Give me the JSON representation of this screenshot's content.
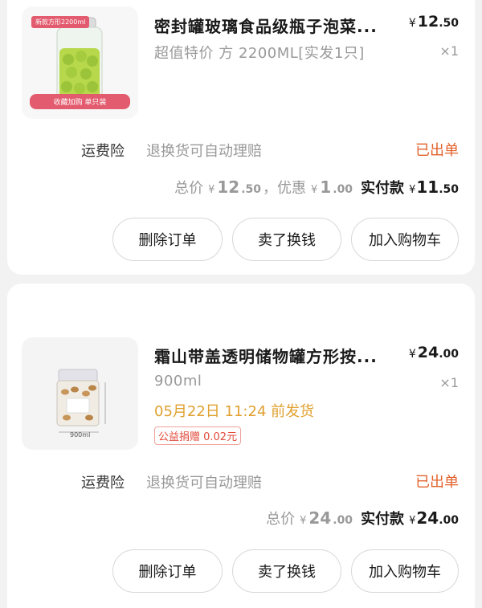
{
  "orders": [
    {
      "image_badge_top": "新款方形2200ml",
      "image_badge_bottom": "收藏加购  单只装",
      "title": "密封罐玻璃食品级瓶子泡菜...",
      "price": {
        "currency": "¥",
        "int": "12",
        "dec": ".50"
      },
      "spec": "超值特价 方 2200ML[实发1只]",
      "quantity": "×1",
      "insurance_label": "运费险",
      "insurance_desc": "退换货可自动理赔",
      "status": "已出单",
      "totals": {
        "total_label": "总价",
        "total_currency": "¥",
        "total_int": "12",
        "total_dec": ".50",
        "discount_label": "，优惠",
        "discount_currency": "¥",
        "discount_int": "1",
        "discount_dec": ".00",
        "paid_label": "实付款",
        "paid_currency": "¥",
        "paid_int": "11",
        "paid_dec": ".50"
      },
      "buttons": [
        "删除订单",
        "卖了换钱",
        "加入购物车"
      ]
    },
    {
      "image_label": "900ml",
      "title": "霜山带盖透明储物罐方形按...",
      "price": {
        "currency": "¥",
        "int": "24",
        "dec": ".00"
      },
      "spec": "900ml",
      "quantity": "×1",
      "ship_time": "05月22日 11:24 前发货",
      "charity_tag": "公益捐赠 0.02元",
      "insurance_label": "运费险",
      "insurance_desc": "退换货可自动理赔",
      "status": "已出单",
      "totals": {
        "total_label": "总价",
        "total_currency": "¥",
        "total_int": "24",
        "total_dec": ".00",
        "paid_label": "实付款",
        "paid_currency": "¥",
        "paid_int": "24",
        "paid_dec": ".00"
      },
      "buttons": [
        "删除订单",
        "卖了换钱",
        "加入购物车"
      ]
    }
  ],
  "colors": {
    "accent_status": "#e3622b",
    "ship_time": "#e0a02e",
    "charity": "#e2493a",
    "background": "#f2f2f2"
  }
}
